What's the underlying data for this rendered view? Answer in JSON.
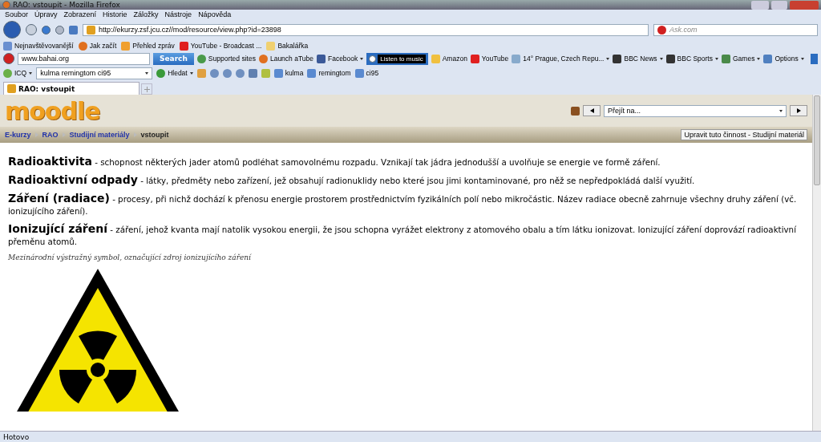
{
  "window": {
    "title": "RAO: vstoupit - Mozilla Firefox"
  },
  "menu": [
    "Soubor",
    "Úpravy",
    "Zobrazení",
    "Historie",
    "Záložky",
    "Nástroje",
    "Nápověda"
  ],
  "nav": {
    "url": "http://ekurzy.zsf.jcu.cz//mod/resource/view.php?id=23898",
    "search_placeholder": "Ask.com"
  },
  "bookmarks": [
    "Nejnavštěvovanější",
    "Jak začít",
    "Přehled zpráv",
    "YouTube - Broadcast ...",
    "Bakalářka"
  ],
  "toolbar": {
    "search_value": "www.bahai.org",
    "search_button": "Search",
    "items": [
      {
        "label": "Supported sites",
        "kind": "link",
        "dropdown": false
      },
      {
        "label": "Launch aTube",
        "kind": "link",
        "dropdown": false
      },
      {
        "label": "Facebook",
        "kind": "link",
        "dropdown": true
      },
      {
        "label": "Listen to music",
        "kind": "player",
        "dropdown": false
      },
      {
        "label": "Amazon",
        "kind": "link",
        "dropdown": false
      },
      {
        "label": "YouTube",
        "kind": "link",
        "dropdown": false
      },
      {
        "label": "14° Prague, Czech Repu...",
        "kind": "link",
        "dropdown": true
      },
      {
        "label": "BBC News",
        "kind": "link",
        "dropdown": true
      },
      {
        "label": "BBC Sports",
        "kind": "link",
        "dropdown": true
      },
      {
        "label": "Games",
        "kind": "link",
        "dropdown": true
      },
      {
        "label": "Options",
        "kind": "link",
        "dropdown": true
      }
    ]
  },
  "icq_bar": {
    "label": "ICQ",
    "field_value": "kulma remingtom ci95",
    "search_button": "Hledat",
    "highlights": [
      "kulma",
      "remingtom",
      "ci95"
    ]
  },
  "tabs": [
    {
      "label": "RAO: vstoupit",
      "selected": true
    }
  ],
  "page": {
    "logo": "moodle",
    "jump_placeholder": "Přejít na...",
    "breadcrumb": [
      {
        "label": "E-kurzy",
        "link": true
      },
      {
        "label": "RAO",
        "link": true
      },
      {
        "label": "Studijní materiály",
        "link": true
      },
      {
        "label": "vstoupit",
        "link": false
      }
    ],
    "edit_button": "Upravit tuto činnost - Studijní materiál",
    "definitions": [
      "**Radioaktivita** - schopnost některých jader atomů podléhat samovolnému rozpadu. Vznikají tak jádra jednodušší a uvolňuje se energie ve formě záření.",
      "**Radioaktivní odpady** - látky, předměty nebo zařízení, jež obsahují radionuklidy nebo které jsou jimi kontaminované, pro něž se nepředpokládá další využití.",
      "**Záření (radiace)** - procesy, při nichž dochází k přenosu energie prostorem prostřednictvím fyzikálních polí nebo mikročástic. Název radiace obecně zahrnuje všechny druhy záření (vč. ionizujícího záření).",
      "**Ionizující záření** - záření, jehož kvanta mají natolik vysokou energii, že jsou schopna vyrážet elektrony z atomového obalu a tím látku ionizovat. Ionizující záření doprovází radioaktivní přeměnu atomů."
    ],
    "caption": "Mezinárodní výstražný symbol, označující zdroj ionizujícího záření"
  },
  "status_bar": {
    "text": "Hotovo"
  }
}
